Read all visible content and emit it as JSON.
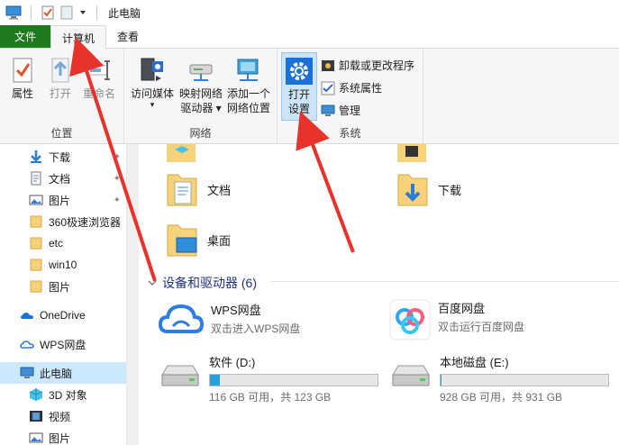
{
  "window": {
    "title": "此电脑"
  },
  "tabs": {
    "file": "文件",
    "computer": "计算机",
    "view": "查看"
  },
  "ribbon": {
    "location": {
      "label": "位置",
      "properties": "属性",
      "open": "打开",
      "rename": "重命名"
    },
    "network": {
      "label": "网络",
      "access_media": "访问媒体",
      "map_drive_1": "映射网络",
      "map_drive_2": "驱动器",
      "add_location_1": "添加一个",
      "add_location_2": "网络位置"
    },
    "system": {
      "label": "系统",
      "open_settings_1": "打开",
      "open_settings_2": "设置",
      "uninstall": "卸载或更改程序",
      "system_props": "系统属性",
      "manage": "管理"
    }
  },
  "nav": {
    "items": [
      {
        "label": "下载",
        "icon": "download-icon",
        "pinned": true
      },
      {
        "label": "文档",
        "icon": "document-icon",
        "pinned": true
      },
      {
        "label": "图片",
        "icon": "pictures-icon",
        "pinned": true
      },
      {
        "label": "360极速浏览器",
        "icon": "folder-icon",
        "pinned": false
      },
      {
        "label": "etc",
        "icon": "folder-icon",
        "pinned": false
      },
      {
        "label": "win10",
        "icon": "folder-icon",
        "pinned": false
      },
      {
        "label": "图片",
        "icon": "folder-icon",
        "pinned": false
      },
      {
        "label": "OneDrive",
        "icon": "onedrive-icon",
        "pinned": false
      },
      {
        "label": "WPS网盘",
        "icon": "wps-cloud-icon",
        "pinned": false
      },
      {
        "label": "此电脑",
        "icon": "this-pc-icon",
        "pinned": false
      },
      {
        "label": "3D 对象",
        "icon": "3d-objects-icon",
        "pinned": false
      },
      {
        "label": "视频",
        "icon": "video-icon",
        "pinned": false
      },
      {
        "label": "图片",
        "icon": "pictures-icon",
        "pinned": false
      }
    ]
  },
  "folders": [
    {
      "label": "文档"
    },
    {
      "label": "下载"
    },
    {
      "label": "桌面"
    }
  ],
  "devices": {
    "header": "设备和驱动器 (6)",
    "items": [
      {
        "name": "WPS网盘",
        "sub": "双击进入WPS网盘",
        "icon": "wps-cloud-icon"
      },
      {
        "name": "百度网盘",
        "sub": "双击运行百度网盘",
        "icon": "baidu-netdisk-icon"
      },
      {
        "name": "软件 (D:)",
        "sub": "116 GB 可用，共 123 GB",
        "used_fraction": 0.057
      },
      {
        "name": "本地磁盘 (E:)",
        "sub": "928 GB 可用，共 931 GB",
        "used_fraction": 0.003
      }
    ]
  }
}
